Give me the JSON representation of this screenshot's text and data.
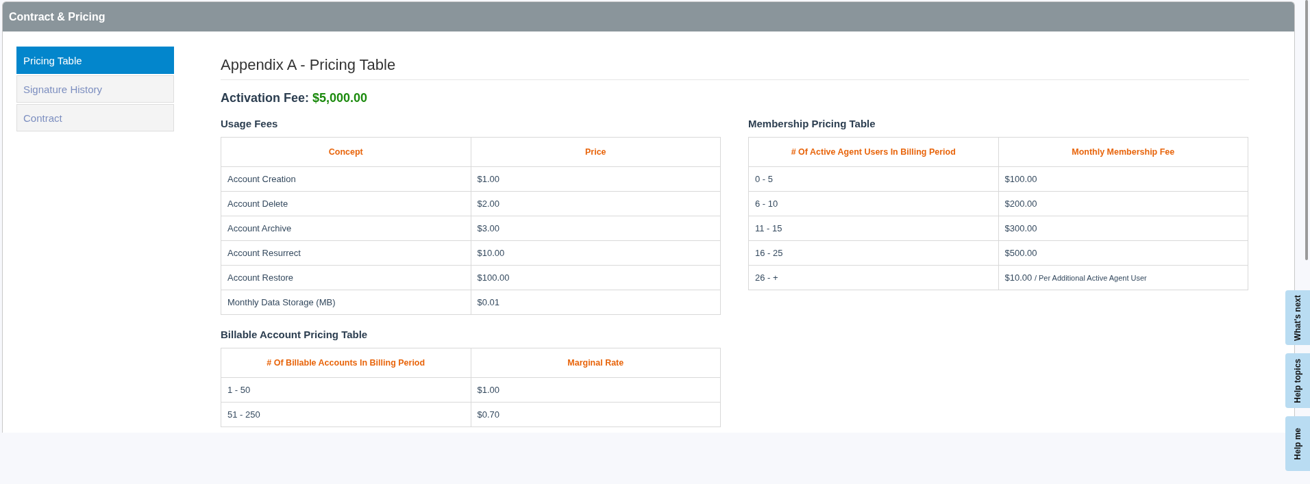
{
  "panel": {
    "title": "Contract & Pricing"
  },
  "sidebar": {
    "items": [
      {
        "label": "Pricing Table",
        "selected": true
      },
      {
        "label": "Signature History",
        "selected": false
      },
      {
        "label": "Contract",
        "selected": false
      }
    ]
  },
  "content": {
    "title": "Appendix A - Pricing Table",
    "activation_fee": {
      "label": "Activation Fee:",
      "value": "$5,000.00"
    },
    "tables": [
      {
        "title": "Usage Fees",
        "columns": [
          "Concept",
          "Price"
        ],
        "rows": [
          [
            {
              "value": "Account Creation"
            },
            {
              "value": "$1.00"
            }
          ],
          [
            {
              "value": "Account Delete"
            },
            {
              "value": "$2.00"
            }
          ],
          [
            {
              "value": "Account Archive"
            },
            {
              "value": "$3.00"
            }
          ],
          [
            {
              "value": "Account Resurrect"
            },
            {
              "value": "$10.00"
            }
          ],
          [
            {
              "value": "Account Restore"
            },
            {
              "value": "$100.00"
            }
          ],
          [
            {
              "value": "Monthly Data Storage (MB)"
            },
            {
              "value": "$0.01"
            }
          ]
        ]
      },
      {
        "title": "Membership Pricing Table",
        "columns": [
          "# Of Active Agent Users In Billing Period",
          "Monthly Membership Fee"
        ],
        "rows": [
          [
            {
              "value": "0 - 5"
            },
            {
              "value": "$100.00"
            }
          ],
          [
            {
              "value": "6 - 10"
            },
            {
              "value": "$200.00"
            }
          ],
          [
            {
              "value": "11 - 15"
            },
            {
              "value": "$300.00"
            }
          ],
          [
            {
              "value": "16 - 25"
            },
            {
              "value": "$500.00"
            }
          ],
          [
            {
              "value": "26 - +"
            },
            {
              "value": "$10.00",
              "note": "/ Per Additional Active Agent User"
            }
          ]
        ]
      },
      {
        "title": "Billable Account Pricing Table",
        "columns": [
          "# Of Billable Accounts In Billing Period",
          "Marginal Rate"
        ],
        "rows": [
          [
            {
              "value": "1 - 50"
            },
            {
              "value": "$1.00"
            }
          ],
          [
            {
              "value": "51 - 250"
            },
            {
              "value": "$0.70"
            }
          ]
        ]
      }
    ]
  },
  "help_tabs": [
    "What's next",
    "Help topics",
    "Help me"
  ]
}
